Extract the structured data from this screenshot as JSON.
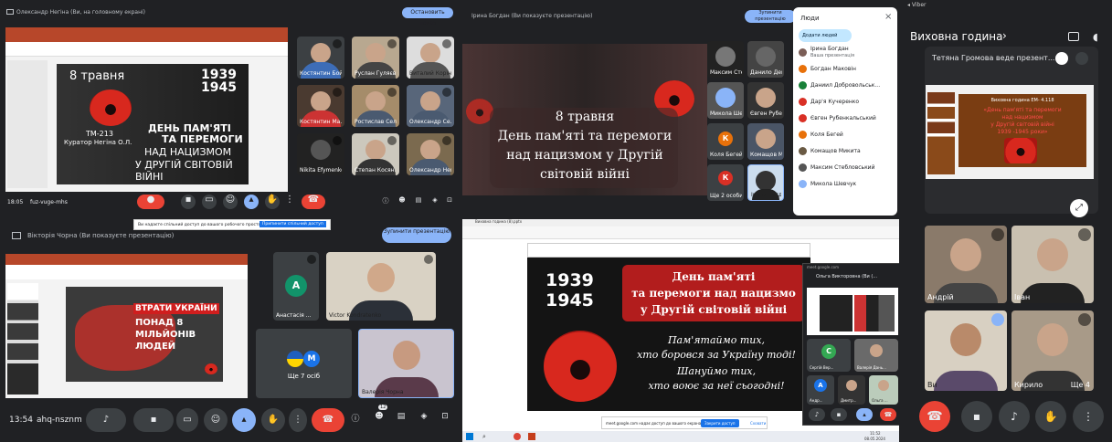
{
  "p1": {
    "presenter": "Олександр Негіна (Ви, на головному екрані)",
    "stop_label": "Остановить показ",
    "time": "18:05",
    "code": "fuz-vuge-mhs",
    "slide": {
      "date": "8 травня",
      "years_top": "1939",
      "years_bottom": "1945",
      "l1": "ДЕНЬ ПАМ'ЯТІ",
      "l2": "ТА ПЕРЕМОГИ",
      "l3": "НАД НАЦИЗМОМ",
      "l4": "У ДРУГІЙ СВІТОВІЙ ВІЙНІ",
      "group": "ТМ-213",
      "curator": "Куратор Негіна О.Л."
    },
    "tiles": [
      "Костянтин Бой...",
      "Руслан Гуляєв",
      "Виталий Корін",
      "Костянтин Ма...",
      "Ростислав Сел...",
      "Олександр Се...",
      "Nikita Efymenko",
      "Степан Косян...",
      "Олександр Нег..."
    ]
  },
  "p2": {
    "presenter": "Ірина Богдан (Ви показуєте презентацію)",
    "stop_label": "Зупинити презентацію",
    "slide": {
      "l1": "8 травня",
      "l2": "День пам'яті та перемоги",
      "l3": "над нацизмом у Другій",
      "l4": "світовій війні"
    },
    "tiles": [
      "Максим Стеб...",
      "Данило Дейр...",
      "Микола Шев...",
      "Євген Рубенк...",
      "Коля Бегей",
      "Комащов Мик...",
      "Ще 2 особи",
      "Ірина Богдан"
    ],
    "tile_initials": [
      "К",
      "К"
    ],
    "people": {
      "title": "Люди",
      "add": "Додати людей",
      "list": [
        "Ірина Богдан",
        "Богдан Маковін",
        "Даниил Добровольськ...",
        "Дар'я Кучеренко",
        "Євген Рубенкальський",
        "Коля Бегей",
        "Комащов Микита",
        "Максим Стебловський",
        "Микола Шевчук"
      ],
      "sub": "Ваша презентація",
      "close": "×"
    }
  },
  "p3": {
    "carrier": "◂ Viber",
    "title": "Виховна година",
    "arrow": "›",
    "presenter": "Тетяна Громова веде презент...",
    "slide": {
      "l1": "Виховна година ЕМ- 4.118",
      "l2": "«День пам'яті та перемоги",
      "l3": "над нацизмом",
      "l4": "у Другій світовій війні",
      "l5": "1939 -1945 роки»"
    },
    "tiles": [
      "Андрій",
      "Іван",
      "Ви",
      "Кирило"
    ],
    "more": "Ще 4"
  },
  "p4": {
    "banner": "Ви надаєте спільний доступ до вашого робочого простору.",
    "banner_btn": "Припинити спільний доступ",
    "banner_hide": "Сховати",
    "presenter": "Вікторія Чорна (Ви показуєте презентацію)",
    "stop_label": "Зупинити презентацію",
    "time": "13:54",
    "code": "ahq-nsznm",
    "slide": {
      "title": "ВТРАТИ УКРАЇНИ",
      "l1": "ПОНАД 8",
      "l2": "МІЛЬЙОНІВ",
      "l3": "ЛЮДЕЙ"
    },
    "tiles": [
      "Анастасія ...",
      "Victor Kondratenko",
      "Ще 7 осіб",
      "Валерія Чорна"
    ],
    "initials": [
      "А",
      "М"
    ],
    "badge": "12"
  },
  "p5": {
    "sheet_title": "Виховна година (8).pptx",
    "slide": {
      "y1": "1939",
      "y2": "1945",
      "h1": "День пам'яті",
      "h2": "та перемоги над нацизмо",
      "h3": "у Другій світовій війні",
      "p1": "Пам'ятаймо тих,",
      "p2": "хто боровся за Україну тоді!",
      "p3": "Шануймо тих,",
      "p4": "хто воює за неї сьогодні!"
    },
    "meet_url": "meet.google.com",
    "meet_who": "Ольга Викторовна (Ви (...",
    "tiles": [
      "Сергій Вер...",
      "Валерія Дань...",
      "Андр...",
      "Дмитр...",
      "Ольга ..."
    ],
    "initials": [
      "С",
      "А"
    ],
    "share_bar": "meet.google.com надає доступ до вашого екрана.",
    "share_stop": "Закрити доступ",
    "share_hide": "Сховати",
    "clock": "11:52",
    "date": "08.05.2024"
  }
}
